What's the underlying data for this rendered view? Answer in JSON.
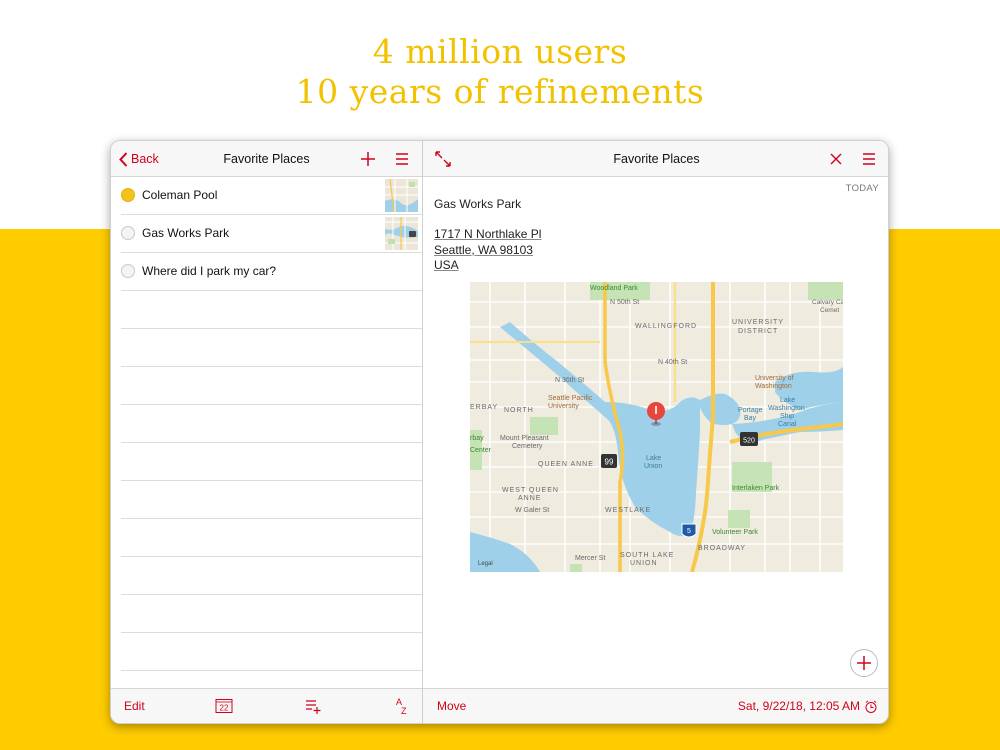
{
  "headline": {
    "line1": "4 million users",
    "line2": "10 years of refinements"
  },
  "left_pane": {
    "back_label": "Back",
    "title": "Favorite Places",
    "items": [
      {
        "label": "Coleman Pool",
        "status": "active",
        "has_thumbnail": true
      },
      {
        "label": "Gas Works Park",
        "status": "inactive",
        "has_thumbnail": true
      },
      {
        "label": "Where did I park my car?",
        "status": "inactive",
        "has_thumbnail": false
      }
    ],
    "toolbar": {
      "edit_label": "Edit",
      "calendar_day": "22",
      "sort_label": "AZ"
    }
  },
  "right_pane": {
    "title": "Favorite Places",
    "date_header": "TODAY",
    "note_title": "Gas Works Park",
    "address_lines": [
      "1717 N Northlake Pl",
      "Seattle, WA 98103",
      "USA"
    ],
    "map_labels": {
      "woodland_park": "Woodland Park",
      "wallingford": "WALLINGFORD",
      "university_district": "UNIVERSITY\nDISTRICT",
      "calvary": "Calvary Ca\nCemet",
      "uw": "University of\nWashington",
      "north": "NORTH",
      "spu": "Seattle Pacific\nUniversity",
      "portage_bay": "Portage\nBay",
      "lake_washington_canal": "Lake\nWashington\nShip\nCanal",
      "mount_pleasant": "Mount Pleasant\nCemetery",
      "queen_anne": "QUEEN ANNE",
      "lake_union": "Lake\nUnion",
      "west_queen_anne": "WEST QUEEN\nANNE",
      "interlaken": "Interlaken Park",
      "westlake": "WESTLAKE",
      "volunteer_park": "Volunteer Park",
      "broadway": "BROADWAY",
      "south_lake_union": "SOUTH LAKE\nUNION",
      "w_galer": "W Galer St",
      "mercer": "Mercer St",
      "n50": "N 50th St",
      "n40": "N 40th St",
      "n36": "N 36th St",
      "legal": "Legal",
      "route_99": "99",
      "route_520": "520",
      "route_5": "5",
      "rbay": "rbay",
      "center": "Center",
      "erbay": "ERBAY"
    },
    "toolbar": {
      "move_label": "Move",
      "datetime": "Sat, 9/22/18, 12:05 AM"
    }
  },
  "colors": {
    "accent": "#d0021b",
    "brand_yellow": "#ffcc00",
    "headline": "#f2c200",
    "pin": "#e8453c"
  },
  "icons": {
    "back": "chevron-left-icon",
    "add": "plus-icon",
    "menu": "hamburger-icon",
    "expand": "expand-arrows-icon",
    "close": "close-icon",
    "calendar": "calendar-icon",
    "list_add": "list-add-icon",
    "sort": "sort-az-icon",
    "alarm": "alarm-clock-icon",
    "map_pin": "map-pin-icon",
    "fab": "add-circle-icon"
  }
}
